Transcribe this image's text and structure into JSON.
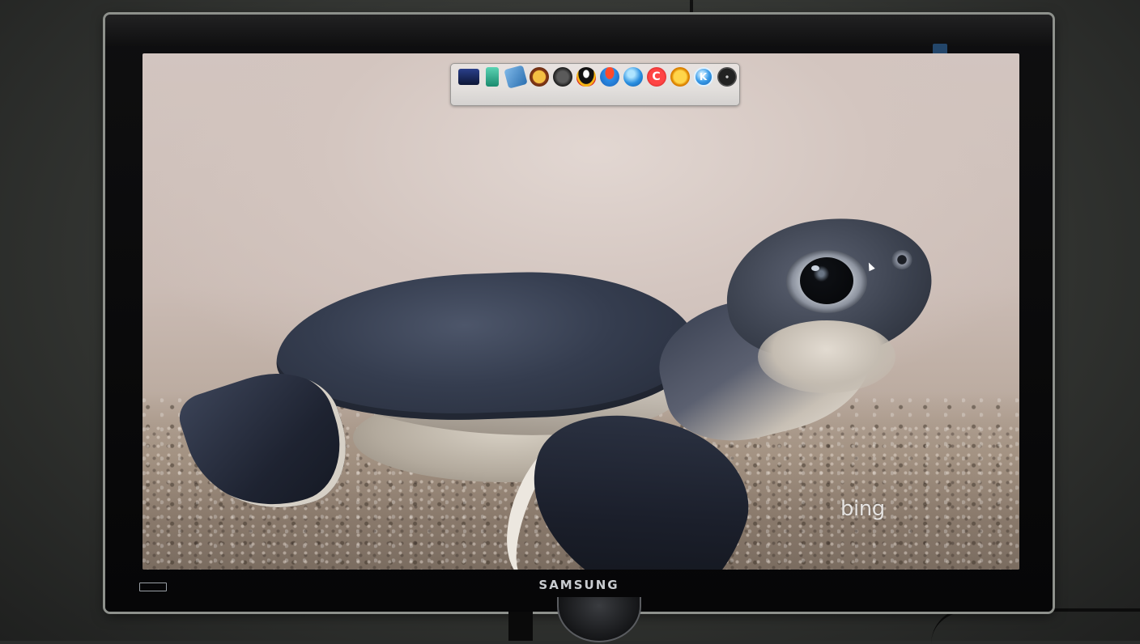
{
  "monitor": {
    "brand": "SAMSUNG"
  },
  "desktop": {
    "wallpaper": {
      "subject": "sea-turtle-hatchling",
      "watermark": "bing"
    }
  },
  "dock": {
    "items": [
      {
        "name": "monitor-app",
        "icon": "monitor-icon",
        "glyph": ""
      },
      {
        "name": "files-app",
        "icon": "files-icon",
        "glyph": ""
      },
      {
        "name": "tools-app",
        "icon": "tools-icon",
        "glyph": ""
      },
      {
        "name": "game-app",
        "icon": "game-icon",
        "glyph": ""
      },
      {
        "name": "crossfire-app",
        "icon": "crossfire-icon",
        "glyph": ""
      },
      {
        "name": "qq-app",
        "icon": "qq-penguin-icon",
        "glyph": ""
      },
      {
        "name": "qq-game-app",
        "icon": "qq-game-icon",
        "glyph": ""
      },
      {
        "name": "browser-app",
        "icon": "browser-icon",
        "glyph": ""
      },
      {
        "name": "c-app",
        "icon": "c-letter-icon",
        "glyph": "C"
      },
      {
        "name": "music-app",
        "icon": "music-icon",
        "glyph": ""
      },
      {
        "name": "k-app",
        "icon": "k-letter-icon",
        "glyph": "K"
      },
      {
        "name": "disc-app",
        "icon": "disc-icon",
        "glyph": ""
      }
    ]
  },
  "colors": {
    "bezel": "#0b0b0c",
    "bezel_edge": "#8e918c",
    "wallpaper_top": "#d8ccc7",
    "sand": "#9a8a7c"
  }
}
